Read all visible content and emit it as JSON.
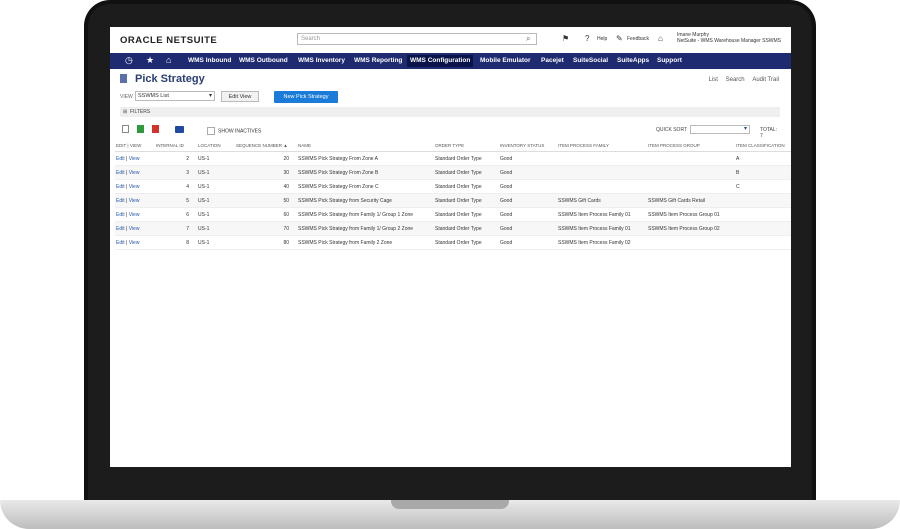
{
  "header": {
    "logo_oracle": "ORACLE",
    "logo_netsuite": "NETSUITE",
    "search_placeholder": "Search",
    "help_label": "Help",
    "feedback_label": "Feedback",
    "user_name": "Imane Murphy",
    "user_role": "NetSuite - WMS Warehouse Manager SSWMS"
  },
  "nav": {
    "items": [
      "WMS Inbound",
      "WMS Outbound",
      "WMS Inventory",
      "WMS Reporting",
      "WMS Configuration",
      "Mobile Emulator",
      "Pacejet",
      "SuiteSocial",
      "SuiteApps",
      "Support"
    ],
    "active": "WMS Configuration"
  },
  "page": {
    "title": "Pick Strategy",
    "links": [
      "List",
      "Search",
      "Audit Trail"
    ],
    "view_label": "VIEW",
    "view_value": "SSWMS List",
    "edit_view_label": "Edit View",
    "new_button_label": "New Pick Strategy",
    "filters_label": "FILTERS",
    "show_inactives_label": "SHOW INACTIVES",
    "quick_sort_label": "QUICK SORT",
    "total_label": "TOTAL: 7"
  },
  "table": {
    "columns": [
      "EDIT | VIEW",
      "INTERNAL ID",
      "LOCATION",
      "SEQUENCE NUMBER ▲",
      "NAME",
      "ORDER TYPE",
      "INVENTORY STATUS",
      "ITEM PROCESS FAMILY",
      "ITEM PROCESS GROUP",
      "ITEM CLASSIFICATION"
    ],
    "edit_label": "Edit",
    "view_label": "View",
    "rows": [
      {
        "id": "2",
        "location": "US-1",
        "seq": "20",
        "name": "SSWMS Pick Strategy From Zone A",
        "order_type": "Standard Order Type",
        "status": "Good",
        "family": "",
        "group": "",
        "classification": "A"
      },
      {
        "id": "3",
        "location": "US-1",
        "seq": "30",
        "name": "SSWMS Pick Strategy From Zone B",
        "order_type": "Standard Order Type",
        "status": "Good",
        "family": "",
        "group": "",
        "classification": "B"
      },
      {
        "id": "4",
        "location": "US-1",
        "seq": "40",
        "name": "SSWMS Pick Strategy From Zone C",
        "order_type": "Standard Order Type",
        "status": "Good",
        "family": "",
        "group": "",
        "classification": "C"
      },
      {
        "id": "5",
        "location": "US-1",
        "seq": "50",
        "name": "SSWMS Pick Strategy from Security Cage",
        "order_type": "Standard Order Type",
        "status": "Good",
        "family": "SSWMS Gift Cards",
        "group": "SSWMS Gift Cards Retail",
        "classification": ""
      },
      {
        "id": "6",
        "location": "US-1",
        "seq": "60",
        "name": "SSWMS Pick Strategy from Family 1/ Group 1 Zone",
        "order_type": "Standard Order Type",
        "status": "Good",
        "family": "SSWMS Item Process Family 01",
        "group": "SSWMS Item Process Group 01",
        "classification": ""
      },
      {
        "id": "7",
        "location": "US-1",
        "seq": "70",
        "name": "SSWMS Pick Strategy from Family 1/ Group 2 Zone",
        "order_type": "Standard Order Type",
        "status": "Good",
        "family": "SSWMS Item Process Family 01",
        "group": "SSWMS Item Process Group 02",
        "classification": ""
      },
      {
        "id": "8",
        "location": "US-1",
        "seq": "80",
        "name": "SSWMS Pick Strategy from Family 2 Zone",
        "order_type": "Standard Order Type",
        "status": "Good",
        "family": "SSWMS Item Process Family 02",
        "group": "",
        "classification": ""
      }
    ]
  },
  "colors": {
    "nav_bg": "#1e2b70",
    "primary_button": "#1a7bd9",
    "link": "#2558b0"
  }
}
